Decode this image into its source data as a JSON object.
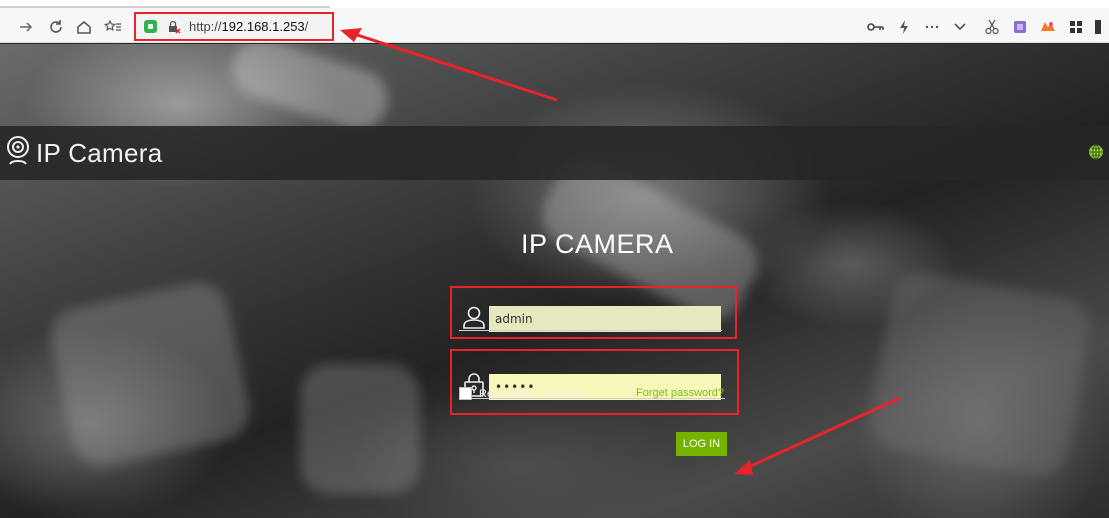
{
  "browser": {
    "url_scheme": "http://",
    "url_host": "192.168.1.253",
    "url_path": "/",
    "nav_icons": [
      "forward-icon",
      "reload-icon",
      "home-icon",
      "favorites-icon"
    ],
    "toolbar_icons": [
      "key-icon",
      "lightning-icon",
      "more-icon",
      "chevron-down-icon",
      "scissors-icon",
      "extension-icon",
      "extension-icon",
      "apps-grid-icon"
    ],
    "annotation_color": "#e8232a"
  },
  "header": {
    "title": "IP Camera",
    "logo_icon": "webcam-icon",
    "language_icon": "globe-icon",
    "accent": "#8cc63f"
  },
  "login": {
    "title": "IP CAMERA",
    "username_value": "admin",
    "password_value": "•••••",
    "remember_label": "Remember username",
    "remember_checked": false,
    "forgot_label": "Forget password?",
    "login_button": "LOG IN",
    "button_color": "#74b300",
    "input_fill": "#f6f7b8"
  }
}
